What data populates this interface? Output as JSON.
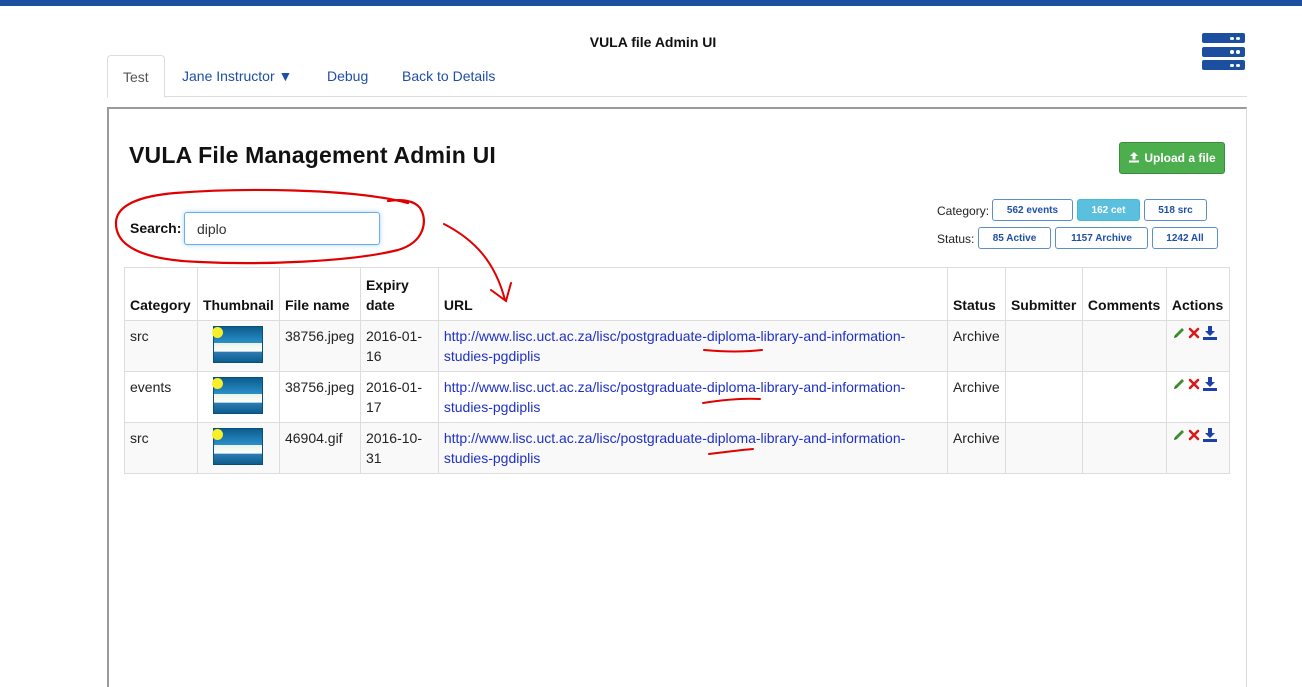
{
  "app": {
    "title": "VULA file Admin UI"
  },
  "tabs": [
    {
      "label": "Test"
    },
    {
      "label": "Jane Instructor ▼"
    },
    {
      "label": "Debug"
    },
    {
      "label": "Back to Details"
    }
  ],
  "main": {
    "title": "VULA File Management Admin UI",
    "upload_label": "Upload a file"
  },
  "search": {
    "label": "Search:",
    "value": "diplo"
  },
  "filters": {
    "category_label": "Category:",
    "category_buttons": [
      {
        "label": "562 events"
      },
      {
        "label": "162 cet",
        "active": true
      },
      {
        "label": "518 src"
      }
    ],
    "status_label": "Status:",
    "status_buttons": [
      {
        "label": "85 Active"
      },
      {
        "label": "1157 Archive"
      },
      {
        "label": "1242 All"
      }
    ]
  },
  "table": {
    "headers": [
      "Category",
      "Thumbnail",
      "File name",
      "Expiry date",
      "URL",
      "Status",
      "Submitter",
      "Comments",
      "Actions"
    ],
    "rows": [
      {
        "category": "src",
        "file_name": "38756.jpeg",
        "expiry": "2016-01-16",
        "url": "http://www.lisc.uct.ac.za/lisc/postgraduate-diploma-library-and-information-studies-pgdiplis",
        "status": "Archive",
        "submitter": "",
        "comments": ""
      },
      {
        "category": "events",
        "file_name": "38756.jpeg",
        "expiry": "2016-01-17",
        "url": "http://www.lisc.uct.ac.za/lisc/postgraduate-diploma-library-and-information-studies-pgdiplis",
        "status": "Archive",
        "submitter": "",
        "comments": ""
      },
      {
        "category": "src",
        "file_name": "46904.gif",
        "expiry": "2016-10-31",
        "url": "http://www.lisc.uct.ac.za/lisc/postgraduate-diploma-library-and-information-studies-pgdiplis",
        "status": "Archive",
        "submitter": "",
        "comments": ""
      }
    ]
  },
  "icons": {
    "top_right": "server-icon",
    "upload": "upload-icon",
    "row_actions": [
      "pencil-icon",
      "delete-icon",
      "download-icon"
    ]
  },
  "colors": {
    "brand": "#1d4fa0",
    "success": "#4cae4c",
    "info": "#5bc0de",
    "link": "#1f30c8",
    "annotation": "#e00000"
  }
}
